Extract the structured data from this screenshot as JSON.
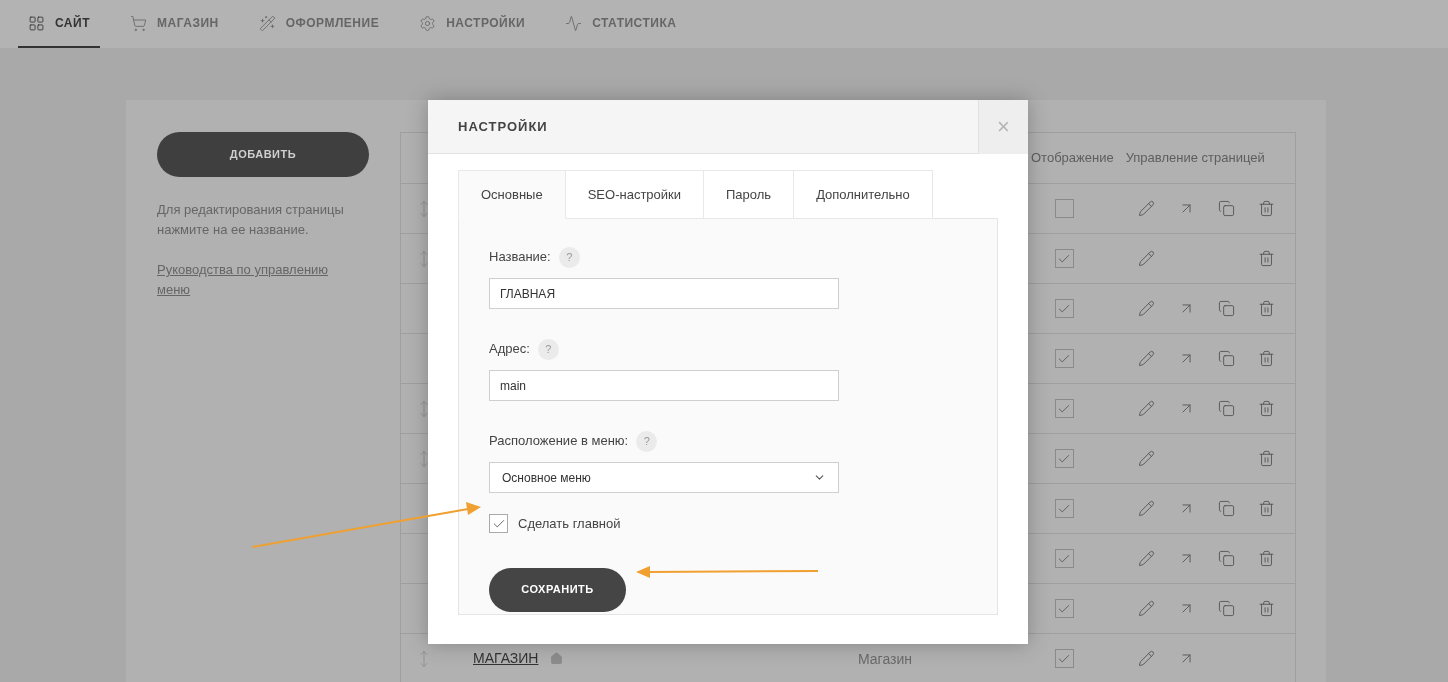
{
  "nav": [
    {
      "label": "САЙТ",
      "selected": true
    },
    {
      "label": "МАГАЗИН",
      "selected": false
    },
    {
      "label": "ОФОРМЛЕНИЕ",
      "selected": false
    },
    {
      "label": "НАСТРОЙКИ",
      "selected": false
    },
    {
      "label": "СТАТИСТИКА",
      "selected": false
    }
  ],
  "sidebar": {
    "add_button": "ДОБАВИТЬ",
    "hint": "Для редактирования страницы нажмите на ее название.",
    "guide_link": "Руководства по управлению меню"
  },
  "table": {
    "columns": [
      "Отображение",
      "Управление страницей"
    ],
    "rows": [
      {
        "handle": true,
        "visible": false,
        "edit": true,
        "open": true,
        "copy": true,
        "delete": true
      },
      {
        "handle": true,
        "visible": true,
        "edit": true,
        "open": false,
        "copy": false,
        "delete": true
      },
      {
        "handle": false,
        "visible": true,
        "edit": true,
        "open": true,
        "copy": true,
        "delete": true
      },
      {
        "handle": false,
        "visible": true,
        "edit": true,
        "open": true,
        "copy": true,
        "delete": true
      },
      {
        "handle": true,
        "visible": true,
        "edit": true,
        "open": true,
        "copy": true,
        "delete": true
      },
      {
        "handle": true,
        "visible": true,
        "edit": true,
        "open": false,
        "copy": false,
        "delete": true
      },
      {
        "handle": false,
        "visible": true,
        "edit": true,
        "open": true,
        "copy": true,
        "delete": true
      },
      {
        "handle": false,
        "visible": true,
        "edit": true,
        "open": true,
        "copy": true,
        "delete": true
      },
      {
        "handle": false,
        "visible": true,
        "edit": true,
        "open": true,
        "copy": true,
        "delete": true
      },
      {
        "handle": true,
        "name": "МАГАЗИН",
        "home": true,
        "type": "Магазин",
        "visible": true,
        "edit": true,
        "open": true,
        "copy": false,
        "delete": false
      }
    ]
  },
  "modal": {
    "title": "НАСТРОЙКИ",
    "close": "×",
    "tabs": [
      {
        "label": "Основные",
        "selected": true
      },
      {
        "label": "SEO-настройки",
        "selected": false
      },
      {
        "label": "Пароль",
        "selected": false
      },
      {
        "label": "Дополнительно",
        "selected": false
      }
    ],
    "fields": [
      {
        "kind": "text",
        "label": "Название:",
        "help": "?",
        "value": "ГЛАВНАЯ"
      },
      {
        "kind": "text",
        "label": "Адрес:",
        "help": "?",
        "value": "main"
      },
      {
        "kind": "select",
        "label": "Расположение в меню:",
        "help": "?",
        "value": "Основное меню"
      }
    ],
    "checkbox": {
      "label": "Сделать главной",
      "checked": true
    },
    "save_button": "СОХРАНИТЬ"
  }
}
